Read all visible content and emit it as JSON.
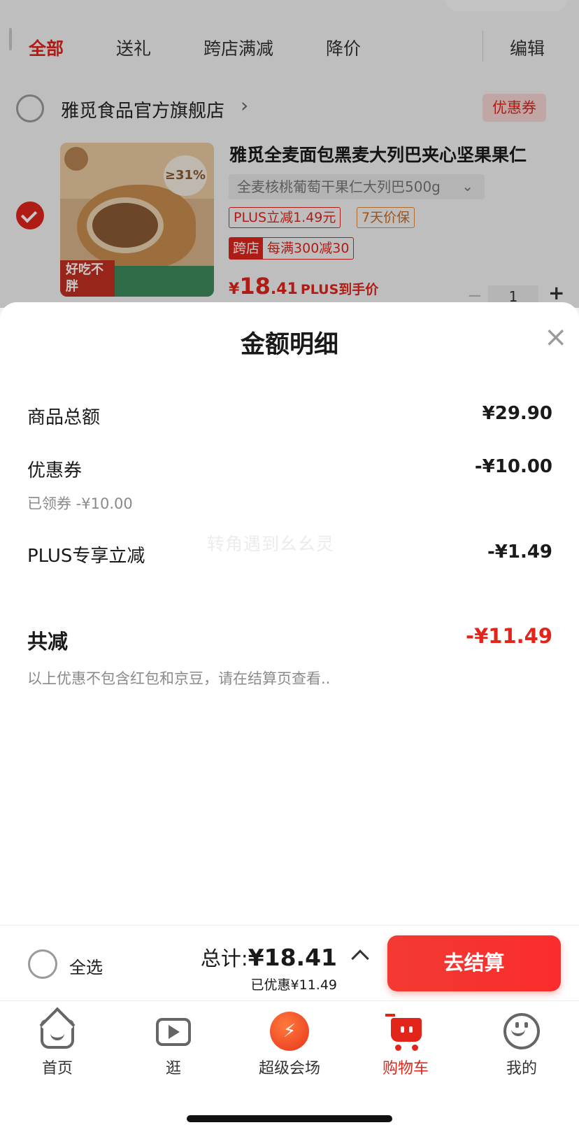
{
  "tabs": [
    {
      "label": "全部",
      "active": true
    },
    {
      "label": "送礼",
      "active": false
    },
    {
      "label": "跨店满减",
      "active": false
    },
    {
      "label": "降价",
      "active": false
    }
  ],
  "edit_label": "编辑",
  "shop": {
    "name": "雅觅食品官方旗舰店",
    "chevron": "›",
    "coupon_tag": "优惠券"
  },
  "product": {
    "title": "雅觅全麦面包黑麦大列巴夹心坚果果仁",
    "spec": "全麦核桃葡萄干果仁大列巴500g",
    "spec_chevron": "⌄",
    "tags": [
      "PLUS立减1.49元",
      "7天价保"
    ],
    "cross_store": {
      "label": "跨店",
      "text": "每满300减30"
    },
    "price": {
      "symbol": "¥",
      "integer": "18",
      "decimal": ".41",
      "label": "PLUS到手价"
    },
    "quantity": "1",
    "image_text": {
      "badge": "≥31%",
      "promo": "好吃不胖"
    }
  },
  "sheet": {
    "title": "金额明细",
    "close": "×",
    "rows": [
      {
        "label": "商品总额",
        "value": "¥29.90"
      },
      {
        "label": "优惠券",
        "value": "-¥10.00",
        "note": "已领券 -¥10.00"
      },
      {
        "label": "PLUS专享立减",
        "value": "-¥1.49"
      }
    ],
    "total_label": "共减",
    "total_value": "-¥11.49",
    "disclaimer": "以上优惠不包含红包和京豆，请在结算页查看..",
    "watermark": "转角遇到幺幺灵"
  },
  "checkout": {
    "select_all": "全选",
    "total_prefix": "总计:",
    "total_amount": "¥18.41",
    "saved": "已优惠¥11.49",
    "pay_button": "去结算"
  },
  "tabbar": [
    {
      "label": "首页",
      "icon": "home-icon"
    },
    {
      "label": "逛",
      "icon": "video-icon"
    },
    {
      "label": "超级会场",
      "icon": "super-venue-icon"
    },
    {
      "label": "购物车",
      "icon": "cart-icon",
      "active": true
    },
    {
      "label": "我的",
      "icon": "profile-icon"
    }
  ],
  "colors": {
    "accent": "#e1251b",
    "pay_button": "#f23a32"
  }
}
